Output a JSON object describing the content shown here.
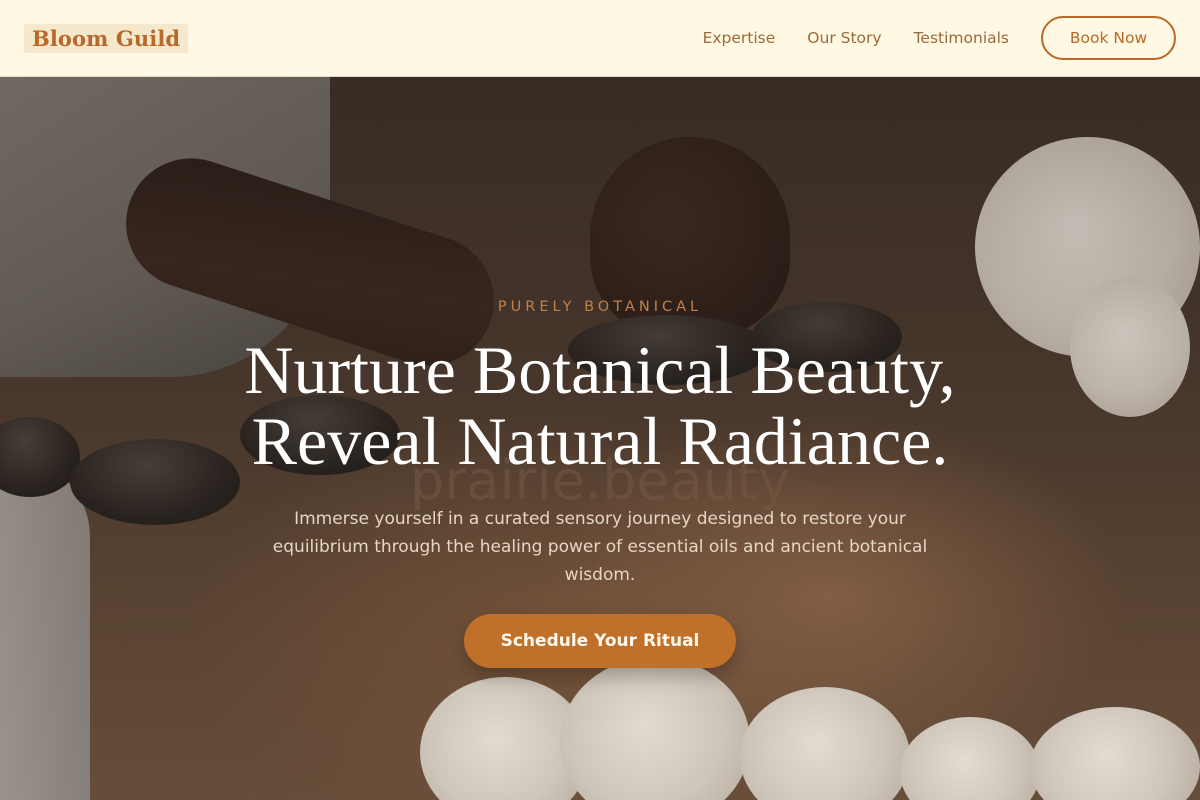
{
  "header": {
    "logo": "Bloom Guild",
    "nav": [
      {
        "label": "Expertise"
      },
      {
        "label": "Our Story"
      },
      {
        "label": "Testimonials"
      }
    ],
    "book_label": "Book Now"
  },
  "hero": {
    "eyebrow": "PURELY BOTANICAL",
    "headline_line1": "Nurture Botanical Beauty,",
    "headline_line2": "Reveal Natural Radiance.",
    "watermark": "prairie.beauty",
    "subtext": "Immerse yourself in a curated sensory journey designed to restore your equilibrium through the healing power of essential oils and ancient botanical wisdom.",
    "cta_label": "Schedule Your Ritual"
  },
  "colors": {
    "accent": "#c07028",
    "nav_bg": "#fff8e3",
    "nav_text": "#9a6a3a",
    "eyebrow": "#c4804a"
  }
}
